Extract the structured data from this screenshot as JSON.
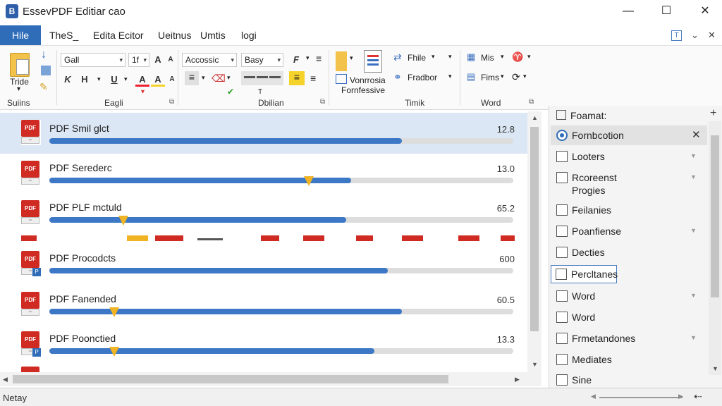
{
  "window": {
    "title": "EssevPDF Editiar cao",
    "icon": "app-logo-icon",
    "minimize": "—",
    "maximize": "☐",
    "close": "✕"
  },
  "menu": {
    "items": [
      "Hile",
      "TheS_",
      "Edita Ecitor",
      "Ueitnus",
      "Umtis",
      "logi"
    ],
    "right_box": "T",
    "right_caret": "⌄",
    "right_close": "✕"
  },
  "ribbon": {
    "paste_label": "Tride",
    "group_labels": [
      "Suiins",
      "Eagli",
      "Dbilian",
      "Timik",
      "Word"
    ],
    "font_name": "Gall",
    "font_size": "1f",
    "style_name": "Accossic",
    "style_name2": "Basy",
    "new_doc_label": "Vonrrosia",
    "new_doc_sub": "Fornfessive",
    "insert_items": [
      "Fhile",
      "Fradbor"
    ],
    "word_items": [
      "Mis",
      "Fims"
    ],
    "bold": "K",
    "italic": "H",
    "underline": "U",
    "f_btn": "F",
    "tr_label": "T"
  },
  "documents": [
    {
      "title": "PDF Smil glct",
      "value": "12.8",
      "progress": 0.76,
      "marker": null,
      "badge": false
    },
    {
      "title": "PDF Serederc",
      "value": "13.0",
      "progress": 0.65,
      "marker": 0.56,
      "badge": false
    },
    {
      "title": "PDF PLF mctuld",
      "value": "65.2",
      "progress": 0.64,
      "marker": 0.16,
      "badge": false
    },
    {
      "title": "PDF Procodcts",
      "value": "600",
      "progress": 0.73,
      "marker": null,
      "badge": true
    },
    {
      "title": "PDF Fanended",
      "value": "60.5",
      "progress": 0.76,
      "marker": 0.14,
      "badge": false
    },
    {
      "title": "PDF Poonctied",
      "value": "13.3",
      "progress": 0.7,
      "marker": 0.14,
      "badge": true
    }
  ],
  "format_panel": {
    "title": "Foamat:",
    "plus": "+",
    "items": [
      {
        "label": "Fornbcotion",
        "type": "radio",
        "active": true
      },
      {
        "label": "Looters",
        "type": "checkbox",
        "caret": true
      },
      {
        "label": "Rcoreenst",
        "label2": "Progies",
        "type": "checkbox",
        "caret": true
      },
      {
        "label": "Feilanies",
        "type": "checkbox"
      },
      {
        "label": "Poanfiense",
        "type": "checkbox",
        "caret": true
      },
      {
        "label": "Decties",
        "type": "checkbox"
      },
      {
        "label": "Percltanes",
        "type": "checkbox",
        "focused": true
      },
      {
        "label": "Word",
        "type": "checkbox",
        "caret": true
      },
      {
        "label": "Word",
        "type": "checkbox"
      },
      {
        "label": "Frmetandones",
        "type": "checkbox",
        "caret": true
      },
      {
        "label": "Mediates",
        "type": "checkbox"
      },
      {
        "label": "Sine",
        "type": "checkbox"
      }
    ]
  },
  "status": {
    "text": "Netay"
  },
  "colors": {
    "accent": "#2f6db8",
    "progress": "#3d78c6",
    "marker": "#f0b323",
    "pdf_red": "#cf2b23"
  }
}
